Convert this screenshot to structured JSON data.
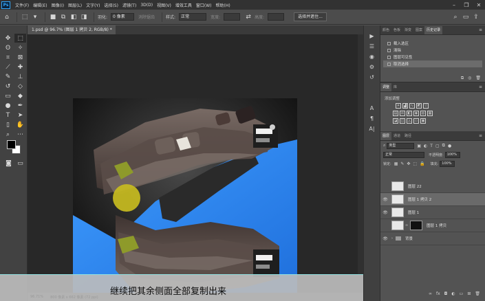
{
  "menu": {
    "logo": "Ps",
    "items": [
      "文件(F)",
      "编辑(E)",
      "图像(I)",
      "图层(L)",
      "文字(Y)",
      "选择(S)",
      "滤镜(T)",
      "3D(D)",
      "视图(V)",
      "增效工具",
      "窗口(W)",
      "帮助(H)"
    ]
  },
  "options": {
    "feather_label": "羽化:",
    "feather_value": "0 像素",
    "antialias_label": "消除锯齿",
    "style_label": "样式:",
    "style_value": "正常",
    "width_label": "宽度:",
    "height_label": "高度:",
    "select_mask_button": "选择并遮住..."
  },
  "document": {
    "tab_title": "1.psd @ 96.7% (图层 1 拷贝 2, RGB/8) *"
  },
  "status": {
    "zoom": "96.71%",
    "doc_size": "800 像素 x 662 像素 (72 ppi)"
  },
  "subtitle": "继续把其余侧面全部复制出来",
  "history_panel": {
    "tabs": [
      "颜色",
      "色板",
      "渐变",
      "图案",
      "历史记录"
    ],
    "items": [
      "载入选区",
      "清除",
      "图层可见性",
      "取消选择"
    ]
  },
  "adjust_panel": {
    "tabs": [
      "调整",
      "库"
    ],
    "title": "添加调整"
  },
  "layers_panel": {
    "tabs": [
      "图层",
      "通道",
      "路径"
    ],
    "filter_kind": "类型",
    "blend_mode": "正常",
    "opacity_label": "不透明度:",
    "opacity_value": "100%",
    "lock_label": "锁定:",
    "fill_label": "填充:",
    "fill_value": "100%",
    "layers": [
      {
        "name": "图层 22"
      },
      {
        "name": "图层 1 拷贝 2"
      },
      {
        "name": "图层 1"
      },
      {
        "name": "图层 1 拷贝"
      },
      {
        "name": "背景"
      }
    ]
  },
  "colors": {
    "accent_blue": "#2e8bf0",
    "marker_yellow": "#c8bc1f"
  }
}
